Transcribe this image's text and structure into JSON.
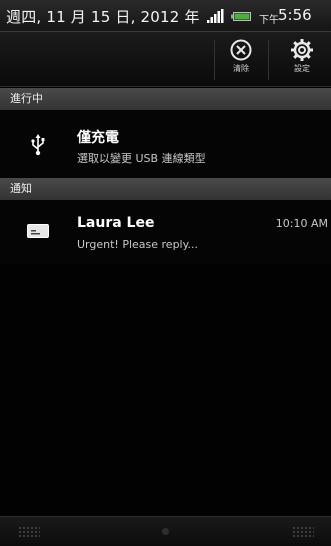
{
  "status_bar": {
    "date": "週四, 11 月 15 日, 2012 年",
    "ampm": "下午",
    "time": "5:56",
    "icons": [
      "signal-icon",
      "battery-icon"
    ],
    "accent_color": "#4caf3a"
  },
  "toolbar": {
    "clear_label": "清除",
    "settings_label": "設定",
    "icons": [
      "clear-icon",
      "settings-gear-icon"
    ]
  },
  "sections": {
    "ongoing_header": "進行中",
    "notifications_header": "通知"
  },
  "ongoing": {
    "icon": "usb-icon",
    "title": "僅充電",
    "subtitle": "選取以變更 USB 連線類型"
  },
  "notifications": [
    {
      "icon": "message-icon",
      "title": "Laura Lee",
      "subtitle": "Urgent! Please reply...",
      "time": "10:10 AM"
    }
  ]
}
